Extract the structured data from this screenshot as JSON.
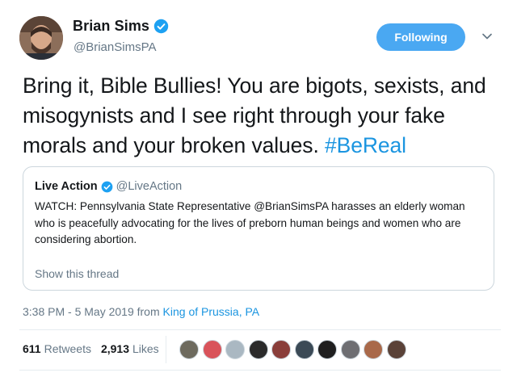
{
  "author": {
    "name": "Brian Sims",
    "handle": "@BrianSimsPA",
    "verified": true
  },
  "follow_button": {
    "label": "Following"
  },
  "tweet": {
    "text": "Bring it, Bible Bullies! You are bigots, sexists, and misogynists and I see right through your fake morals and your broken values.",
    "hashtag": "#BeReal"
  },
  "quoted_tweet": {
    "author_name": "Live Action",
    "author_handle": "@LiveAction",
    "text": "WATCH: Pennsylvania State Representative @BrianSimsPA harasses an elderly woman who is peacefully advocating for the lives of preborn human beings and women who are considering abortion.",
    "show_thread_label": "Show this thread"
  },
  "metadata": {
    "time_date": "3:38 PM - 5 May 2019 from",
    "location": "King of Prussia, PA"
  },
  "stats": {
    "retweets_count": "611",
    "retweets_label": "Retweets",
    "likes_count": "2,913",
    "likes_label": "Likes"
  },
  "likers": [
    {
      "color": "#6d6a5e"
    },
    {
      "color": "#d9535a"
    },
    {
      "color": "#aab8c2"
    },
    {
      "color": "#2b2b2b"
    },
    {
      "color": "#8a3e3a"
    },
    {
      "color": "#3b4a56"
    },
    {
      "color": "#1f1f1f"
    },
    {
      "color": "#6e6e72"
    },
    {
      "color": "#a9694a"
    },
    {
      "color": "#5a4238"
    }
  ],
  "colors": {
    "accent": "#1b95e0",
    "button": "#4aa8f2",
    "muted": "#657786"
  }
}
